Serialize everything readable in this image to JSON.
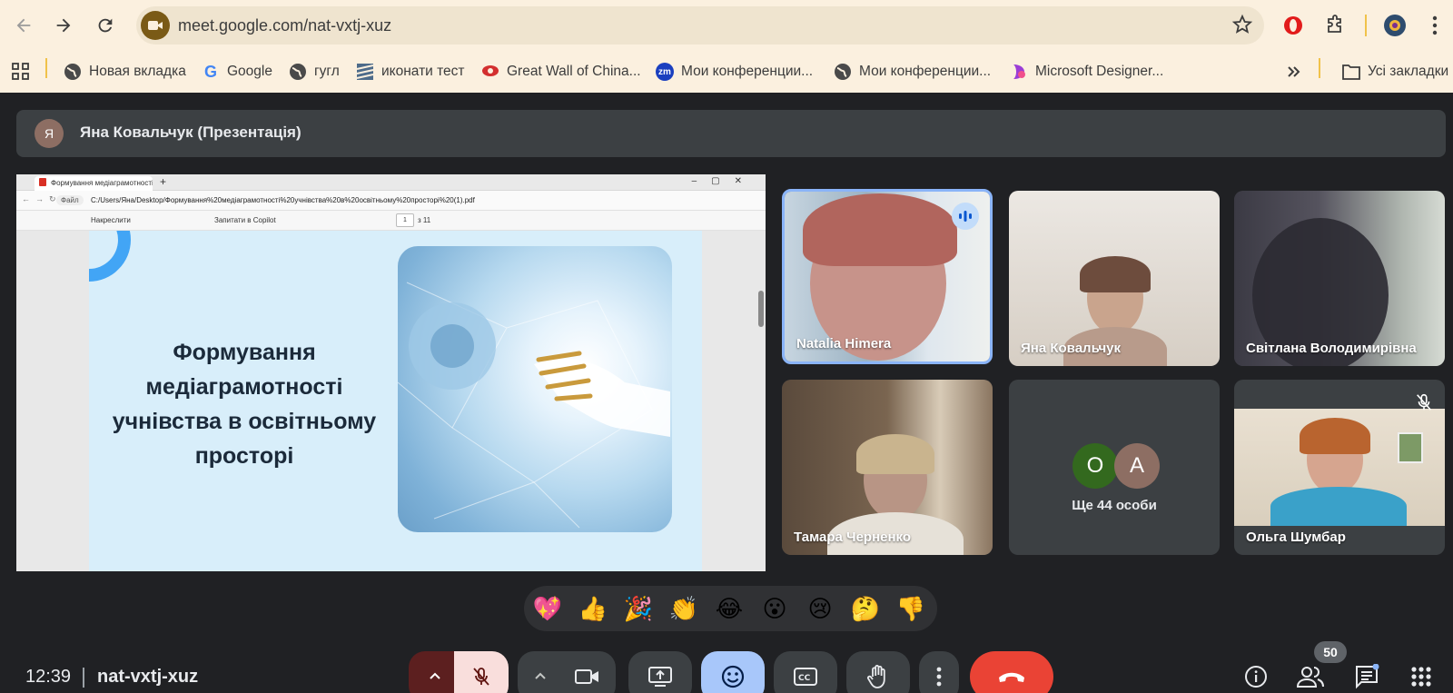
{
  "browser": {
    "url": "meet.google.com/nat-vxtj-xuz",
    "bookmarks": [
      {
        "label": "Новая вкладка",
        "icon": "globe-icon"
      },
      {
        "label": "Google",
        "icon": "google-icon"
      },
      {
        "label": "гугл",
        "icon": "globe-icon"
      },
      {
        "label": "иконати тест",
        "icon": "stack-icon"
      },
      {
        "label": "Great Wall of China...",
        "icon": "wall-icon"
      },
      {
        "label": "Мои конференции...",
        "icon": "zoom-icon"
      },
      {
        "label": "Мои конференции...",
        "icon": "globe-icon"
      },
      {
        "label": "Microsoft Designer...",
        "icon": "designer-icon"
      }
    ],
    "all_bookmarks": "Усі закладки"
  },
  "presenter": {
    "initial": "Я",
    "label": "Яна Ковальчук (Презентація)"
  },
  "shared_screen": {
    "tab_title": "Формування медіаграмотності",
    "file_chip": "Файл",
    "path": "C:/Users/Яна/Desktop/Формування%20медіаграмотності%20учнівства%20в%20освітньому%20просторі%20(1).pdf",
    "draw_label": "Накреслити",
    "copilot_label": "Запитати в Copilot",
    "page_current": "1",
    "page_total": "з 11",
    "slide_title": "Формування медіаграмотності учнівства в освітньому просторі"
  },
  "participants": [
    {
      "name": "Natalia Himera",
      "speaking": true
    },
    {
      "name": "Яна Ковальчук"
    },
    {
      "name": "Світлана Володимирівна"
    },
    {
      "name": "Тамара Черненко"
    },
    {
      "name": "Ще 44 особи",
      "avatars": [
        "О",
        "А"
      ],
      "avatar_colors": [
        "#33691e",
        "#8d6e63"
      ]
    },
    {
      "name": "Ольга Шумбар",
      "muted": true
    }
  ],
  "reactions": [
    "💖",
    "👍",
    "🎉",
    "👏",
    "😂",
    "😮",
    "😢",
    "🤔",
    "👎"
  ],
  "bottom": {
    "time": "12:39",
    "meeting_code": "nat-vxtj-xuz",
    "people_count": "50"
  },
  "colors": {
    "leave_button": "#ea4335",
    "reaction_active": "#a8c7fa",
    "mic_off": "#f9dedc"
  }
}
